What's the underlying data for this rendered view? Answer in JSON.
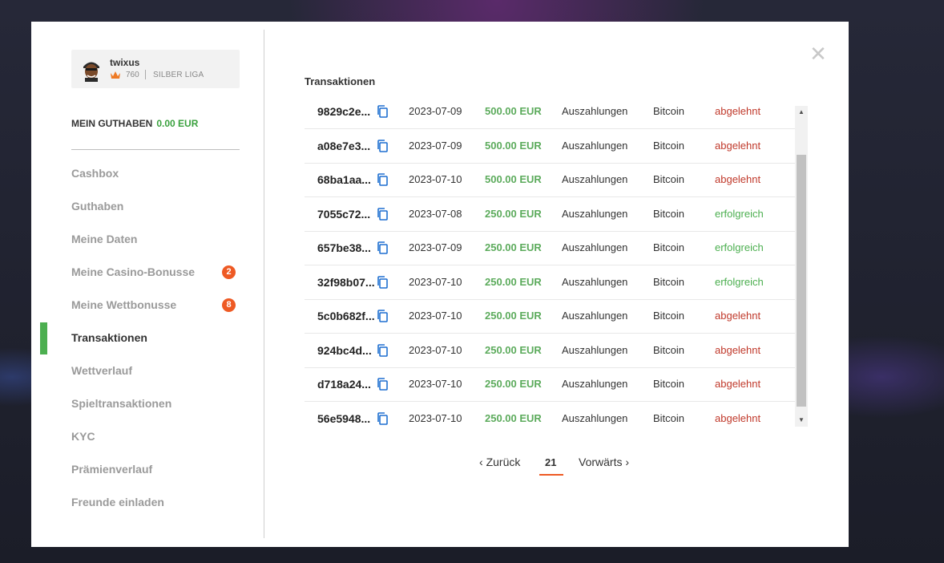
{
  "user": {
    "name": "twixus",
    "points": "760",
    "league": "SILBER LIGA"
  },
  "balance": {
    "label": "MEIN GUTHABEN",
    "amount": "0.00 EUR"
  },
  "menu": [
    {
      "label": "Cashbox"
    },
    {
      "label": "Guthaben"
    },
    {
      "label": "Meine Daten"
    },
    {
      "label": "Meine Casino-Bonusse",
      "badge": "2"
    },
    {
      "label": "Meine Wettbonusse",
      "badge": "8"
    },
    {
      "label": "Transaktionen",
      "active": true
    },
    {
      "label": "Wettverlauf"
    },
    {
      "label": "Spieltransaktionen"
    },
    {
      "label": "KYC"
    },
    {
      "label": "Prämienverlauf"
    },
    {
      "label": "Freunde einladen"
    }
  ],
  "main": {
    "title": "Transaktionen"
  },
  "transactions": [
    {
      "id": "9829c2e...",
      "date": "2023-07-09",
      "amount": "500.00 EUR",
      "type": "Auszahlungen",
      "method": "Bitcoin",
      "status": "abgelehnt"
    },
    {
      "id": "a08e7e3...",
      "date": "2023-07-09",
      "amount": "500.00 EUR",
      "type": "Auszahlungen",
      "method": "Bitcoin",
      "status": "abgelehnt"
    },
    {
      "id": "68ba1aa...",
      "date": "2023-07-10",
      "amount": "500.00 EUR",
      "type": "Auszahlungen",
      "method": "Bitcoin",
      "status": "abgelehnt"
    },
    {
      "id": "7055c72...",
      "date": "2023-07-08",
      "amount": "250.00 EUR",
      "type": "Auszahlungen",
      "method": "Bitcoin",
      "status": "erfolgreich"
    },
    {
      "id": "657be38...",
      "date": "2023-07-09",
      "amount": "250.00 EUR",
      "type": "Auszahlungen",
      "method": "Bitcoin",
      "status": "erfolgreich"
    },
    {
      "id": "32f98b07...",
      "date": "2023-07-10",
      "amount": "250.00 EUR",
      "type": "Auszahlungen",
      "method": "Bitcoin",
      "status": "erfolgreich"
    },
    {
      "id": "5c0b682f...",
      "date": "2023-07-10",
      "amount": "250.00 EUR",
      "type": "Auszahlungen",
      "method": "Bitcoin",
      "status": "abgelehnt"
    },
    {
      "id": "924bc4d...",
      "date": "2023-07-10",
      "amount": "250.00 EUR",
      "type": "Auszahlungen",
      "method": "Bitcoin",
      "status": "abgelehnt"
    },
    {
      "id": "d718a24...",
      "date": "2023-07-10",
      "amount": "250.00 EUR",
      "type": "Auszahlungen",
      "method": "Bitcoin",
      "status": "abgelehnt"
    },
    {
      "id": "56e5948...",
      "date": "2023-07-10",
      "amount": "250.00 EUR",
      "type": "Auszahlungen",
      "method": "Bitcoin",
      "status": "abgelehnt"
    }
  ],
  "pagination": {
    "prev": "Zurück",
    "current": "21",
    "next": "Vorwärts"
  },
  "colors": {
    "accent_green": "#4caf50",
    "amount_green": "#5cab5c",
    "rejected_red": "#c0392b",
    "badge_orange": "#ee5a24"
  },
  "icons": {
    "copy": "copy-icon",
    "close": "close-icon",
    "crown": "crown-icon"
  }
}
